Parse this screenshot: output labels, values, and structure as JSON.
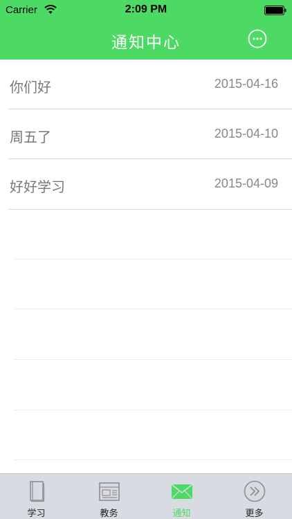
{
  "status_bar": {
    "carrier": "Carrier",
    "time": "2:09 PM",
    "icons": [
      "wifi-icon",
      "battery-icon"
    ]
  },
  "nav": {
    "title": "通知中心",
    "more_icon": "ellipsis-circle-icon"
  },
  "notifications": [
    {
      "subject": "你们好",
      "date": "2015-04-16"
    },
    {
      "subject": "周五了",
      "date": "2015-04-10"
    },
    {
      "subject": "好好学习",
      "date": "2015-04-09"
    }
  ],
  "tabs": [
    {
      "label": "学习",
      "icon": "book-icon",
      "active": false
    },
    {
      "label": "教务",
      "icon": "newspaper-icon",
      "active": false
    },
    {
      "label": "通知",
      "icon": "envelope-icon",
      "active": true
    },
    {
      "label": "更多",
      "icon": "double-chevron-right-icon",
      "active": false
    }
  ],
  "colors": {
    "accent": "#4cd964",
    "tab_bar_bg": "#d9dbe3",
    "subject_text": "#777777",
    "date_text": "#888888"
  }
}
